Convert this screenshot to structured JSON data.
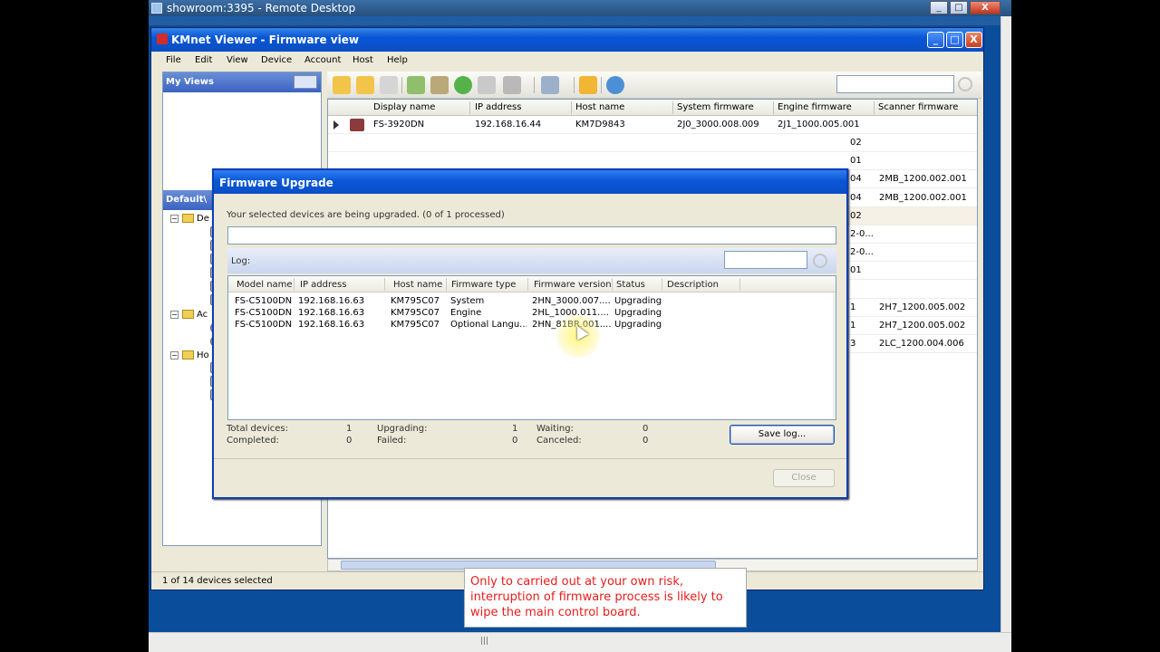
{
  "remote_desktop": {
    "title": "showroom:3395 - Remote Desktop",
    "min": "_",
    "max": "□",
    "close": "X"
  },
  "kmnet": {
    "title": "KMnet Viewer - Firmware view",
    "min": "_",
    "max": "□",
    "close": "X",
    "menu": [
      "File",
      "Edit",
      "View",
      "Device",
      "Account",
      "Host",
      "Help"
    ],
    "my_views": "My Views",
    "default_view": "Default\\",
    "tree": [
      {
        "label": "De"
      },
      {
        "label": "Ac"
      },
      {
        "label": "Ho"
      }
    ],
    "grid": {
      "columns": [
        "Display name",
        "IP address",
        "Host name",
        "System firmware",
        "Engine firmware",
        "Scanner firmware"
      ],
      "rows": [
        {
          "name": "FS-3920DN",
          "ip": "192.168.16.44",
          "host": "KM7D9843",
          "sys": "2J0_3000.008.009",
          "eng": "2J1_1000.005.001",
          "scan": ""
        }
      ],
      "partial_eng": [
        "02",
        "01",
        "04",
        "04",
        "02",
        "2-0...",
        "2-0...",
        "01",
        "",
        "1",
        "1",
        "3"
      ],
      "partial_scan": [
        "",
        "",
        "2MB_1200.002.001",
        "2MB_1200.002.001",
        "",
        "",
        "",
        "",
        "",
        "2H7_1200.005.002",
        "2H7_1200.005.002",
        "2LC_1200.004.006"
      ]
    },
    "status": "1 of 14 devices selected"
  },
  "dialog": {
    "title": "Firmware Upgrade",
    "message": "Your selected devices are being upgraded. (0 of 1 processed)",
    "log_label": "Log:",
    "columns": [
      "Model name",
      "IP address",
      "Host name",
      "Firmware type",
      "Firmware version",
      "Status",
      "Description"
    ],
    "rows": [
      {
        "model": "FS-C5100DN",
        "ip": "192.168.16.63",
        "host": "KM795C07",
        "type": "System",
        "version": "2HN_3000.007....",
        "status": "Upgrading"
      },
      {
        "model": "FS-C5100DN",
        "ip": "192.168.16.63",
        "host": "KM795C07",
        "type": "Engine",
        "version": "2HL_1000.011....",
        "status": "Upgrading"
      },
      {
        "model": "FS-C5100DN",
        "ip": "192.168.16.63",
        "host": "KM795C07",
        "type": "Optional Langu...",
        "version": "2HN_81BR.001....",
        "status": "Upgrading"
      }
    ],
    "stats": {
      "total_label": "Total devices:",
      "total": "1",
      "completed_label": "Completed:",
      "completed": "0",
      "upgrading_label": "Upgrading:",
      "upgrading": "1",
      "failed_label": "Failed:",
      "failed": "0",
      "waiting_label": "Waiting:",
      "waiting": "0",
      "canceled_label": "Canceled:",
      "canceled": "0"
    },
    "save_log": "Save log...",
    "close": "Close"
  },
  "note": "Only to carried out at your own risk, interruption of firmware process is likely to wipe the main control board.",
  "colors": {
    "xp_blue": "#0b57d8",
    "note_red": "#e81c1c"
  }
}
